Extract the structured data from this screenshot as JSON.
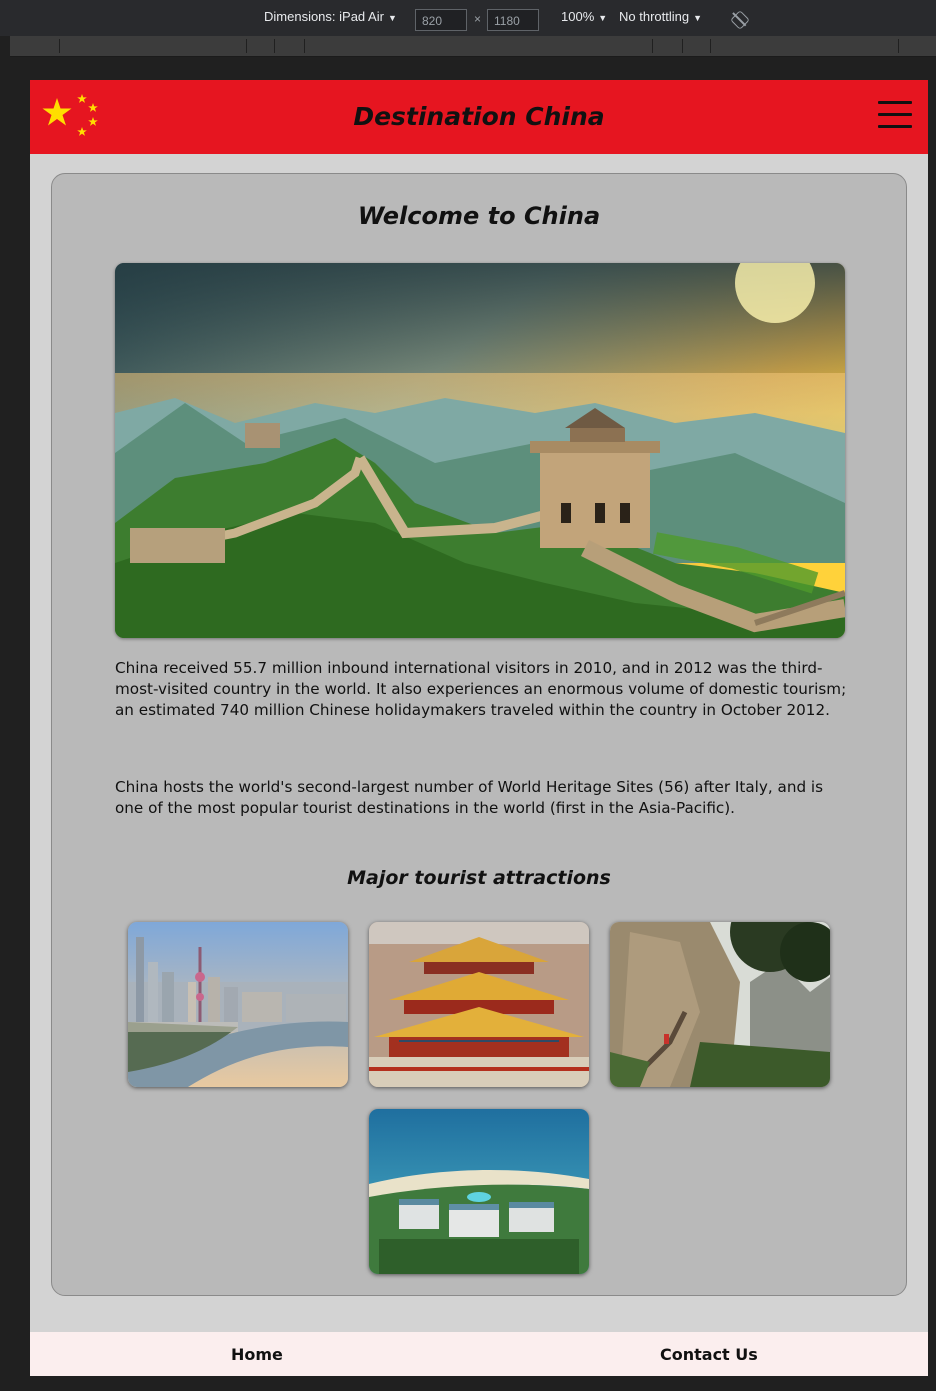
{
  "devtools": {
    "dimensions_label": "Dimensions: iPad Air",
    "width_value": "820",
    "height_value": "1180",
    "zoom": "100%",
    "throttling": "No throttling"
  },
  "header": {
    "title": "Destination China"
  },
  "main": {
    "title": "Welcome to China",
    "paragraph1": "China received 55.7 million inbound international visitors in 2010, and in 2012 was the third-most-visited country in the world. It also experiences an enormous volume of domestic tourism; an estimated 740 million Chinese holidaymakers traveled within the country in October 2012.",
    "paragraph2": "China hosts the world's second-largest number of World Heritage Sites (56) after Italy, and is one of the most popular tourist destinations in the world (first in the Asia-Pacific).",
    "attractions_title": "Major tourist attractions"
  },
  "footer": {
    "home": "Home",
    "contact": "Contact Us"
  },
  "colors": {
    "header_red": "#e61520",
    "flag_star": "#ffde00",
    "card_bg": "#b9b9b9",
    "page_bg": "#d3d3d3",
    "footer_bg": "#fbeeee"
  }
}
